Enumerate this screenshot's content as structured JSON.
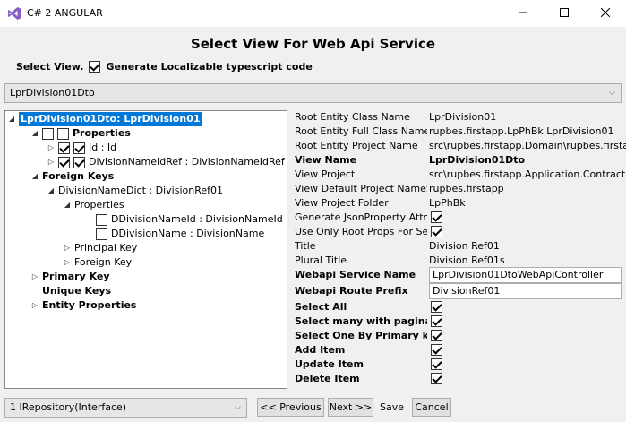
{
  "window": {
    "title": "C# 2 ANGULAR",
    "minimize": "—",
    "maximize": "☐",
    "close": "✕"
  },
  "heading": "Select View For Web Api Service",
  "select_view": {
    "label": "Select View.",
    "checkbox_label": "Generate Localizable typescript code",
    "checked": true
  },
  "view_dropdown": {
    "value": "LprDivision01Dto"
  },
  "tree": {
    "root": "LprDivision01Dto: LprDivision01",
    "properties": "Properties",
    "id": "Id : Id",
    "division_name_id_ref": "DivisionNameIdRef : DivisionNameIdRef",
    "foreign_keys": "Foreign Keys",
    "division_name_dict": "DivisionNameDict : DivisionRef01",
    "fk_properties": "Properties",
    "ddivision_name_id": "DDivisionNameId : DivisionNameId",
    "ddivision_name": "DDivisionName : DivisionName",
    "principal_key": "Principal Key",
    "foreign_key": "Foreign Key",
    "primary_key": "Primary Key",
    "unique_keys": "Unique Keys",
    "entity_properties": "Entity Properties"
  },
  "props": [
    {
      "label": "Root Entity Class Name",
      "value": "LprDivision01",
      "bold": false
    },
    {
      "label": "Root Entity Full Class Name",
      "value": "rupbes.firstapp.LpPhBk.LprDivision01",
      "bold": false
    },
    {
      "label": "Root Entity Project Name",
      "value": "src\\rupbes.firstapp.Domain\\rupbes.firstapp",
      "bold": false
    },
    {
      "label": "View Name",
      "value": "LprDivision01Dto",
      "bold": true
    },
    {
      "label": "View Project",
      "value": "src\\rupbes.firstapp.Application.Contracts\\",
      "bold": false
    },
    {
      "label": "View Default Project NameSpace",
      "value": "rupbes.firstapp",
      "bold": false
    },
    {
      "label": "View Project Folder",
      "value": "LpPhBk",
      "bold": false
    },
    {
      "label": "Generate JsonProperty Attribute",
      "checkbox": true,
      "bold": false
    },
    {
      "label": "Use Only Root Props For Select",
      "checkbox": true,
      "bold": false
    },
    {
      "label": "Title",
      "value": "Division Ref01",
      "bold": false
    },
    {
      "label": "Plural Title",
      "value": "Division Ref01s",
      "bold": false
    },
    {
      "label": "Webapi Service Name",
      "input": "LprDivision01DtoWebApiController",
      "bold": true
    },
    {
      "label": "Webapi Route Prefix",
      "input": "DivisionRef01",
      "bold": true
    },
    {
      "label": "Select All",
      "checkbox": true,
      "bold": true
    },
    {
      "label": "Select many with pagination",
      "checkbox": true,
      "bold": true
    },
    {
      "label": "Select One By Primary key",
      "checkbox": true,
      "bold": true
    },
    {
      "label": "Add Item",
      "checkbox": true,
      "bold": true
    },
    {
      "label": "Update Item",
      "checkbox": true,
      "bold": true
    },
    {
      "label": "Delete Item",
      "checkbox": true,
      "bold": true
    }
  ],
  "repo_dropdown": {
    "value": "1 IRepository(Interface)"
  },
  "buttons": {
    "previous": "<< Previous",
    "next": "Next >>",
    "save": "Save",
    "cancel": "Cancel"
  }
}
